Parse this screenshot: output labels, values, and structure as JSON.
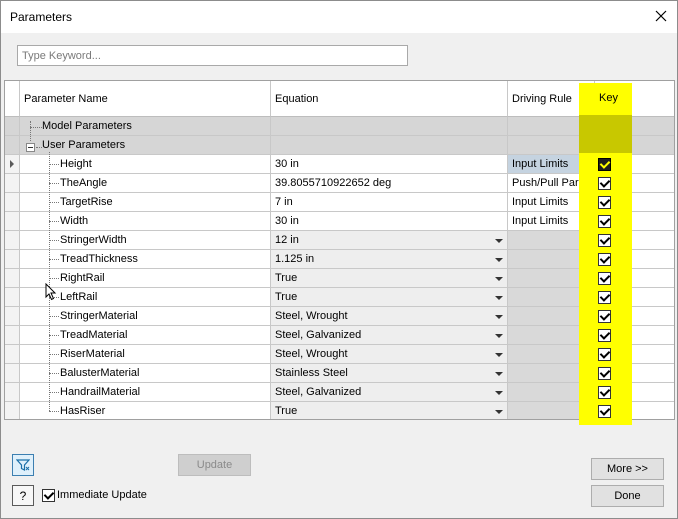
{
  "window": {
    "title": "Parameters"
  },
  "search": {
    "placeholder": "Type Keyword..."
  },
  "table": {
    "columns": {
      "name": "Parameter Name",
      "equation": "Equation",
      "rule": "Driving Rule",
      "key": "Key"
    },
    "groups": {
      "model": "Model Parameters",
      "user": "User Parameters"
    },
    "rows": [
      {
        "name": "Height",
        "equation": "30 in",
        "rule": "Input Limits",
        "dropdown": false,
        "key": true,
        "selected": true
      },
      {
        "name": "TheAngle",
        "equation": "39.8055710922652 deg",
        "rule": "Push/Pull Para...",
        "dropdown": false,
        "key": true
      },
      {
        "name": "TargetRise",
        "equation": "7 in",
        "rule": "Input Limits",
        "dropdown": false,
        "key": true
      },
      {
        "name": "Width",
        "equation": "30 in",
        "rule": "Input Limits",
        "dropdown": false,
        "key": true
      },
      {
        "name": "StringerWidth",
        "equation": "12 in",
        "rule": "",
        "dropdown": true,
        "key": true
      },
      {
        "name": "TreadThickness",
        "equation": "1.125 in",
        "rule": "",
        "dropdown": true,
        "key": true
      },
      {
        "name": "RightRail",
        "equation": "True",
        "rule": "",
        "dropdown": true,
        "key": true
      },
      {
        "name": "LeftRail",
        "equation": "True",
        "rule": "",
        "dropdown": true,
        "key": true
      },
      {
        "name": "StringerMaterial",
        "equation": "Steel, Wrought",
        "rule": "",
        "dropdown": true,
        "key": true
      },
      {
        "name": "TreadMaterial",
        "equation": "Steel, Galvanized",
        "rule": "",
        "dropdown": true,
        "key": true
      },
      {
        "name": "RiserMaterial",
        "equation": "Steel, Wrought",
        "rule": "",
        "dropdown": true,
        "key": true
      },
      {
        "name": "BalusterMaterial",
        "equation": "Stainless Steel",
        "rule": "",
        "dropdown": true,
        "key": true
      },
      {
        "name": "HandrailMaterial",
        "equation": "Steel, Galvanized",
        "rule": "",
        "dropdown": true,
        "key": true
      },
      {
        "name": "HasRiser",
        "equation": "True",
        "rule": "",
        "dropdown": true,
        "key": true
      }
    ]
  },
  "footer": {
    "update_label": "Update",
    "immediate_label": "Immediate Update",
    "immediate_checked": true,
    "more_label": "More >>",
    "done_label": "Done",
    "help_glyph": "?"
  },
  "colors": {
    "key_highlight": "#ffff00",
    "selected_row": "#c5d3e0"
  },
  "icons": [
    "close-icon",
    "filter-icon",
    "help-icon",
    "dropdown-arrow-icon",
    "row-pointer-icon"
  ]
}
